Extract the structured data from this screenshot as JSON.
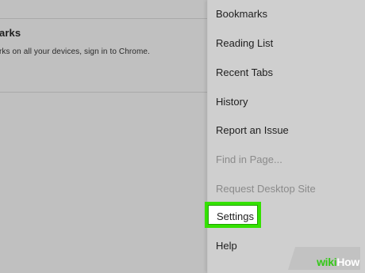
{
  "screen": {
    "background_color": "#c0c0c0"
  },
  "left_panel": {
    "top_fragment": "",
    "bookmarks_section": {
      "title": "arks",
      "description": "rks on all your devices, sign in to Chrome."
    }
  },
  "menu": {
    "background_color": "#cfcfcf",
    "items": [
      {
        "label": "Bookmarks",
        "enabled": true
      },
      {
        "label": "Reading List",
        "enabled": true
      },
      {
        "label": "Recent Tabs",
        "enabled": true
      },
      {
        "label": "History",
        "enabled": true
      },
      {
        "label": "Report an Issue",
        "enabled": true
      },
      {
        "label": "Find in Page...",
        "enabled": false
      },
      {
        "label": "Request Desktop Site",
        "enabled": false
      },
      {
        "label": "Settings",
        "enabled": true,
        "highlighted": true
      },
      {
        "label": "Help",
        "enabled": true
      }
    ]
  },
  "annotation": {
    "highlight_color": "#34e100"
  },
  "watermark": {
    "wiki": "wiki",
    "how": "How",
    "wiki_color": "#34c817",
    "how_color": "#ffffff"
  }
}
